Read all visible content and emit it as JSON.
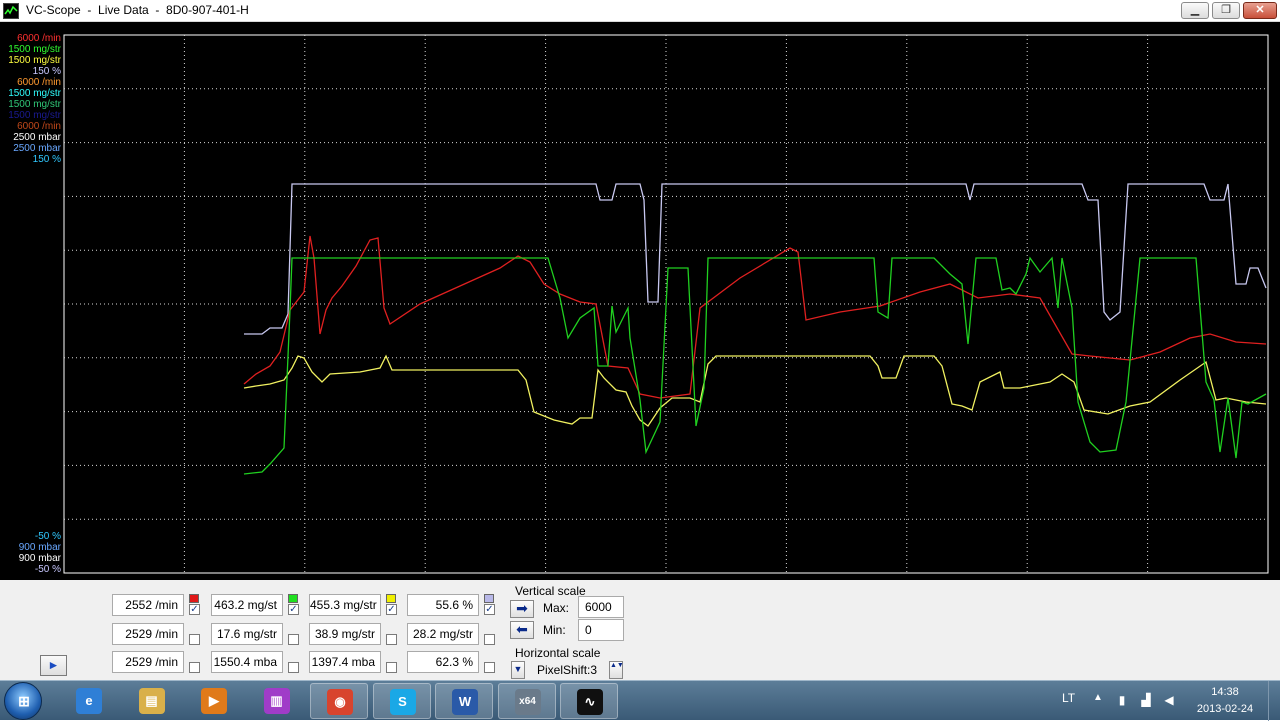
{
  "window": {
    "title": "VC-Scope  -  Live Data  -  8D0-907-401-H",
    "min_glyph": "▁",
    "max_glyph": "❐",
    "close_glyph": "✕"
  },
  "scope": {
    "top_labels": [
      {
        "text": "6000 /min",
        "color": "#ff3030"
      },
      {
        "text": "1500 mg/str",
        "color": "#30ff30"
      },
      {
        "text": "1500 mg/str",
        "color": "#ffff40"
      },
      {
        "text": "150 %",
        "color": "#c8c8ff"
      },
      {
        "text": "6000 /min",
        "color": "#ff9a30"
      },
      {
        "text": "1500 mg/str",
        "color": "#30ffff"
      },
      {
        "text": "1500 mg/str",
        "color": "#30c878"
      },
      {
        "text": "1500 mg/str",
        "color": "#1a1a90"
      },
      {
        "text": "6000 /min",
        "color": "#c0481a"
      },
      {
        "text": "2500 mbar",
        "color": "#ffffff"
      },
      {
        "text": "2500 mbar",
        "color": "#6aa8ff"
      },
      {
        "text": "150 %",
        "color": "#30c8ff"
      }
    ],
    "bottom_labels": [
      {
        "text": "-50 %",
        "color": "#30c8ff"
      },
      {
        "text": "900 mbar",
        "color": "#6aa8ff"
      },
      {
        "text": "900 mbar",
        "color": "#ffffff"
      },
      {
        "text": "-50 %",
        "color": "#c8c8ff"
      }
    ],
    "series_colors": {
      "rpm": "#e02020",
      "mass": "#20d020",
      "requested": "#f0f060",
      "percent": "#c8c8f0"
    }
  },
  "readouts": [
    {
      "value": "2552 /min",
      "color": "#e01818",
      "checked": true
    },
    {
      "value": "463.2 mg/st",
      "color": "#20e020",
      "checked": true
    },
    {
      "value": "455.3 mg/str",
      "color": "#f0f000",
      "checked": true
    },
    {
      "value": "55.6 %",
      "color": "#b8b8e8",
      "checked": true
    },
    {
      "value": "2529 /min",
      "color": "",
      "checked": false
    },
    {
      "value": "17.6 mg/str",
      "color": "",
      "checked": false
    },
    {
      "value": "38.9 mg/str",
      "color": "",
      "checked": false
    },
    {
      "value": "28.2 mg/str",
      "color": "",
      "checked": false
    },
    {
      "value": "2529 /min",
      "color": "",
      "checked": false
    },
    {
      "value": "1550.4 mba",
      "color": "",
      "checked": false
    },
    {
      "value": "1397.4 mba",
      "color": "",
      "checked": false
    },
    {
      "value": "62.3 %",
      "color": "",
      "checked": false
    }
  ],
  "check_glyph": "✓",
  "vertical_scale": {
    "title": "Vertical scale",
    "max_label": "Max:",
    "max_value": "6000",
    "min_label": "Min:",
    "min_value": "0",
    "right_arrow": "➡",
    "left_arrow": "⬅"
  },
  "horizontal_scale": {
    "title": "Horizontal scale",
    "value": "PixelShift:3",
    "down_glyph": "▼",
    "updown_glyph": "▲▼"
  },
  "play_glyph": "►",
  "taskbar": {
    "start_glyph": "⊞",
    "apps": [
      {
        "name": "ie",
        "glyph": "e",
        "color": "#2f7fd6",
        "open": false
      },
      {
        "name": "explorer",
        "glyph": "▤",
        "color": "#d9b04a",
        "open": false
      },
      {
        "name": "media-player",
        "glyph": "▶",
        "color": "#e07a1a",
        "open": false
      },
      {
        "name": "onenote",
        "glyph": "▥",
        "color": "#a03cc8",
        "open": false
      },
      {
        "name": "chrome",
        "glyph": "◉",
        "color": "#d8442e",
        "open": true
      },
      {
        "name": "skype",
        "glyph": "S",
        "color": "#1aa8e6",
        "open": true
      },
      {
        "name": "word",
        "glyph": "W",
        "color": "#2a5aa8",
        "open": true
      },
      {
        "name": "vcds",
        "glyph": "x64",
        "color": "#6a7a8a",
        "open": true
      },
      {
        "name": "vcscope",
        "glyph": "∿",
        "color": "#101010",
        "open": true
      }
    ],
    "lang": "LT",
    "tray_up": "▲",
    "time": "14:38",
    "date": "2013-02-24"
  }
}
